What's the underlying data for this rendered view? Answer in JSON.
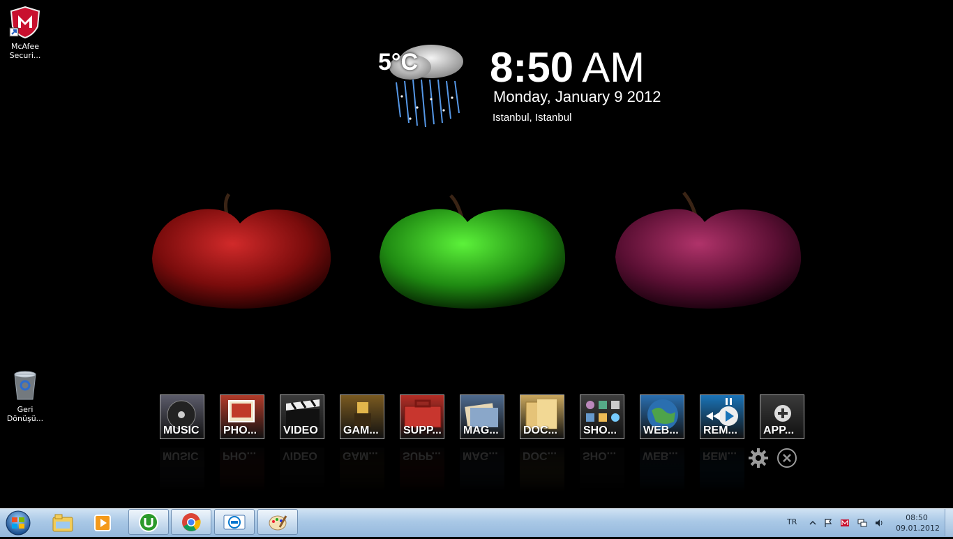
{
  "desktop": {
    "icons": [
      {
        "label": "McAfee Securi..."
      },
      {
        "label": "Geri Dönüşü..."
      }
    ]
  },
  "weather": {
    "temperature": "5°C",
    "condition_icon": "rain-cloud-icon"
  },
  "clock": {
    "time": "8:50",
    "ampm": "AM",
    "date": "Monday, January 9 2012",
    "location": "Istanbul, Istanbul"
  },
  "dock": {
    "tiles": [
      {
        "label": "MUSIC",
        "icon": "music-disc-icon",
        "color": "#5b5b6a"
      },
      {
        "label": "PHO...",
        "icon": "photo-icon",
        "color": "#b23b2a"
      },
      {
        "label": "VIDEO",
        "icon": "clapperboard-icon",
        "color": "#3a3a3a"
      },
      {
        "label": "GAM...",
        "icon": "chess-piece-icon",
        "color": "#7a5a20"
      },
      {
        "label": "SUPP...",
        "icon": "toolbox-icon",
        "color": "#b52d25"
      },
      {
        "label": "MAG...",
        "icon": "magazines-icon",
        "color": "#4f6b8f"
      },
      {
        "label": "DOC...",
        "icon": "folder-icon",
        "color": "#c9a75d"
      },
      {
        "label": "SHO...",
        "icon": "shortcuts-grid-icon",
        "color": "#3d3d3d"
      },
      {
        "label": "WEB...",
        "icon": "globe-icon",
        "color": "#2a6fb0"
      },
      {
        "label": "REM...",
        "icon": "remote-play-icon",
        "color": "#1a74b8"
      },
      {
        "label": "APP...",
        "icon": "add-app-icon",
        "color": "#3a3a3a"
      }
    ]
  },
  "taskbar": {
    "pinned": [
      {
        "icon": "windows-explorer-icon"
      },
      {
        "icon": "media-player-icon"
      },
      {
        "icon": "utorrent-icon"
      },
      {
        "icon": "chrome-icon"
      },
      {
        "icon": "dell-icon"
      },
      {
        "icon": "paint-icon"
      }
    ],
    "tray": {
      "language": "TR",
      "time": "08:50",
      "date": "09.01.2012"
    }
  },
  "colors": {
    "taskbar": "#a9c8e6",
    "background": "#000000"
  }
}
